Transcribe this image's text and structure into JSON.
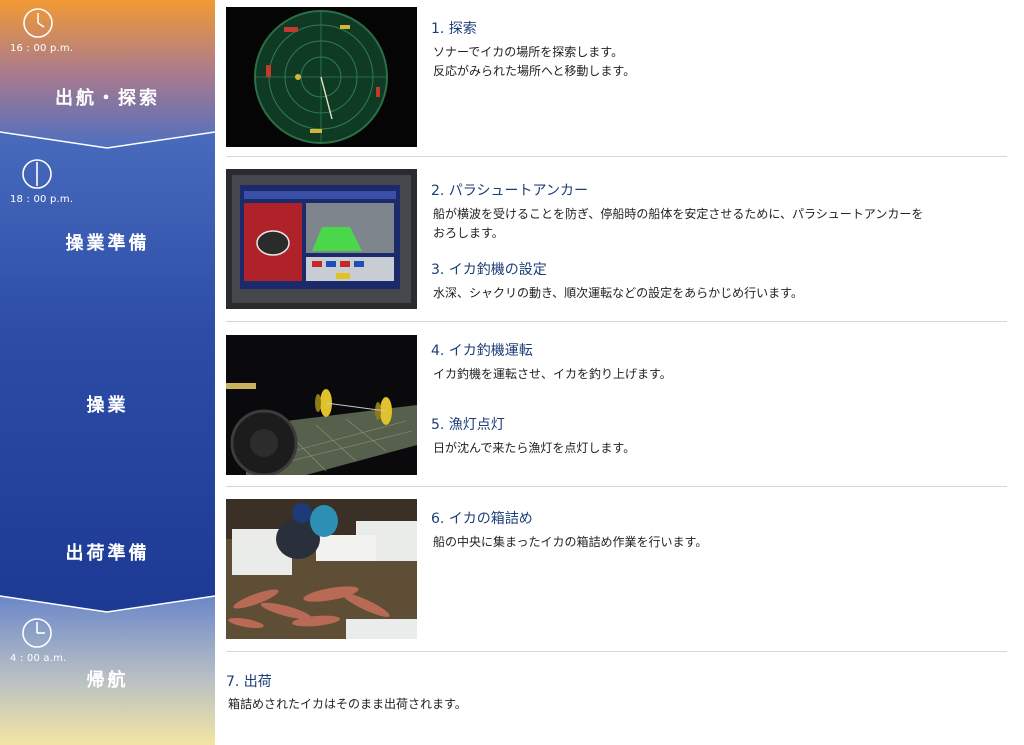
{
  "timeline": {
    "times": [
      "16 : 00 p.m.",
      "18 : 00 p.m.",
      "4 : 00 a.m."
    ],
    "phases": [
      "出航・探索",
      "操業準備",
      "操業",
      "出荷準備",
      "帰航"
    ],
    "colors": {
      "orange": "#f29a34",
      "blue_mid": "#3b5fb3",
      "navy": "#15318a",
      "cream": "#f3e4a4"
    }
  },
  "steps": [
    {
      "title": "1. 探索",
      "desc": [
        "ソナーでイカの場所を探索します。",
        "反応がみられた場所へと移動します。"
      ]
    },
    {
      "title": "2. パラシュートアンカー",
      "desc": [
        "船が横波を受けることを防ぎ、停船時の船体を安定させるために、パラシュートアンカーを",
        "おろします。"
      ]
    },
    {
      "title": "3. イカ釣機の設定",
      "desc": [
        "水深、シャクリの動き、順次運転などの設定をあらかじめ行います。"
      ]
    },
    {
      "title": "4. イカ釣機運転",
      "desc": [
        "イカ釣機を運転させ、イカを釣り上げます。"
      ]
    },
    {
      "title": "5. 漁灯点灯",
      "desc": [
        "日が沈んで来たら漁灯を点灯します。"
      ]
    },
    {
      "title": "6. イカの箱詰め",
      "desc": [
        "船の中央に集まったイカの箱詰め作業を行います。"
      ]
    },
    {
      "title": "7. 出荷",
      "desc": [
        "箱詰めされたイカはそのまま出荷されます。"
      ]
    }
  ],
  "photos": [
    {
      "subject": "sonar-screen"
    },
    {
      "subject": "control-panel"
    },
    {
      "subject": "squid-jigging-machine"
    },
    {
      "subject": "packing-squid"
    }
  ]
}
